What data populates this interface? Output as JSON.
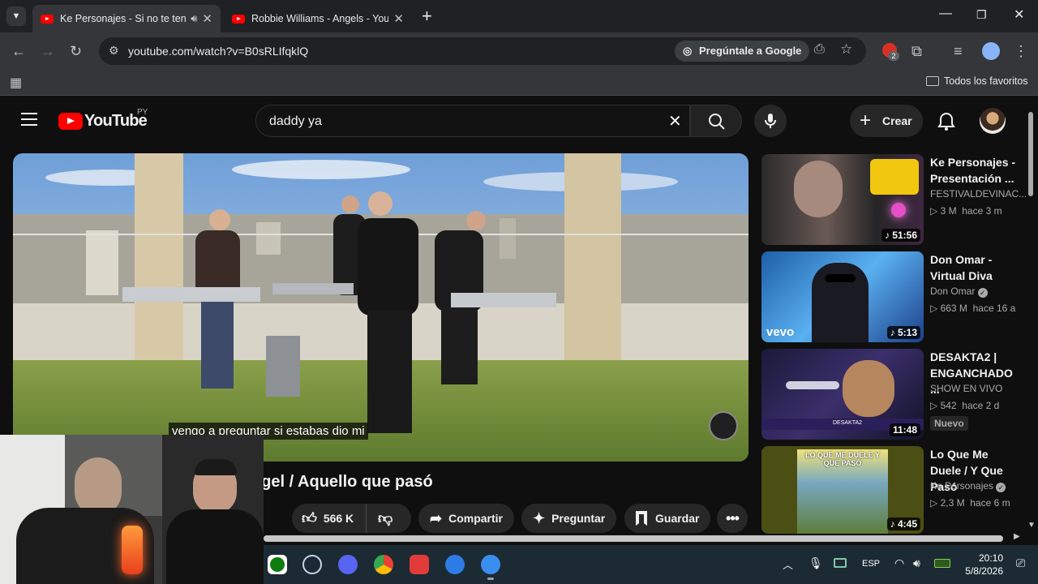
{
  "browser": {
    "tabs": [
      {
        "title": "Ke Personajes - Si no te ten",
        "active": true,
        "audio_icon": "speaker-icon"
      },
      {
        "title": "Robbie Williams - Angels - You",
        "active": false
      }
    ],
    "url": "youtube.com/watch?v=B0sRLIfqklQ",
    "ask_google_label": "Pregúntale a Google",
    "extension_badge": "2",
    "bookmarks_folder": "Todos los favoritos"
  },
  "youtube": {
    "logo_text": "YouTube",
    "country_code": "PY",
    "search_query": "daddy ya",
    "create_label": "Crear",
    "caption": "vengo a preguntar si estabas dio mi",
    "video_title_visible": "ngel / Aquello que pasó",
    "actions": {
      "likes": "566 K",
      "share": "Compartir",
      "ask": "Preguntar",
      "save": "Guardar"
    },
    "recommendations": [
      {
        "title": "Ke Personajes - Presentación ...",
        "channel": "FESTIVALDEVINAC...",
        "views": "3 M",
        "age": "hace 3 m",
        "duration": "51:56",
        "verified": false,
        "badge": ""
      },
      {
        "title": "Don Omar - Virtual Diva",
        "channel": "Don Omar",
        "views": "663 M",
        "age": "hace 16 a",
        "duration": "5:13",
        "verified": true,
        "badge": "",
        "thumb_brand": "vevo"
      },
      {
        "title": "DESAKTA2 | ENGANCHADO ...",
        "channel": "SHOW EN VIVO",
        "views": "542",
        "age": "hace 2 d",
        "duration": "11:48",
        "verified": false,
        "badge": "Nuevo",
        "thumb_caption": "DESAKTA2"
      },
      {
        "title": "Lo Que Me Duele / Y Que Pasó",
        "channel": "Ke Personajes",
        "views": "2,3 M",
        "age": "hace 6 m",
        "duration": "4:45",
        "verified": true,
        "badge": "",
        "thumb_caption": "LO QUE ME DUELE Y QUE PASÓ"
      }
    ]
  },
  "taskbar": {
    "language": "ESP",
    "time": "20:10",
    "date": "5/8/2026"
  }
}
